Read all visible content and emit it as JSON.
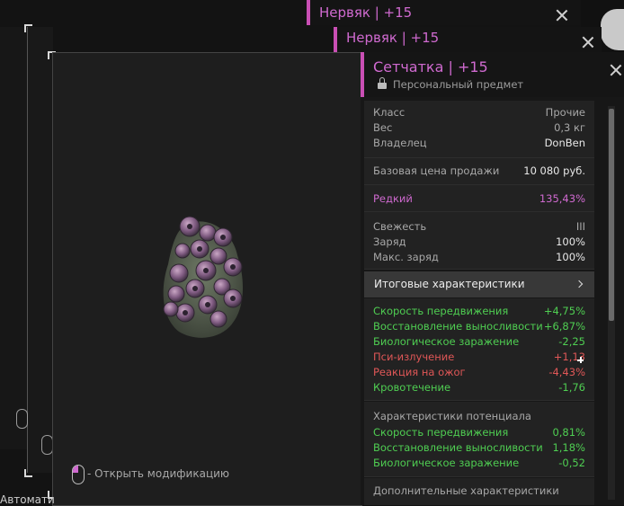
{
  "back_windows": [
    {
      "title": "Нервяк | +15"
    },
    {
      "title": "Нервяк | +15"
    }
  ],
  "window": {
    "title": "Сетчатка | +15",
    "subtitle": "Персональный предмет",
    "colors": {
      "accent": "#c94fb4",
      "positive": "#4fce52",
      "negative": "#e05757",
      "rare": "#d06ad0"
    }
  },
  "info": {
    "class_label": "Класс",
    "class_value": "Прочие",
    "weight_label": "Вес",
    "weight_value": "0,3 кг",
    "owner_label": "Владелец",
    "owner_value": "DonBen"
  },
  "price": {
    "label": "Базовая цена продажи",
    "value": "10 080 руб."
  },
  "rarity": {
    "label": "Редкий",
    "value": "135,43%"
  },
  "condition": {
    "freshness_label": "Свежесть",
    "freshness_value": "III",
    "charge_label": "Заряд",
    "charge_value": "100%",
    "max_charge_label": "Макс. заряд",
    "max_charge_value": "100%"
  },
  "final_stats": {
    "header": "Итоговые характеристики",
    "items": [
      {
        "label": "Скорость передвижения",
        "value": "+4,75%",
        "tone": "green"
      },
      {
        "label": "Восстановление выносливости",
        "value": "+6,87%",
        "tone": "green"
      },
      {
        "label": "Биологическое заражение",
        "value": "-2,25",
        "tone": "green"
      },
      {
        "label": "Пси-излучение",
        "value": "+1,13",
        "tone": "red"
      },
      {
        "label": "Реакция на ожог",
        "value": "-4,43%",
        "tone": "red"
      },
      {
        "label": "Кровотечение",
        "value": "-1,76",
        "tone": "green"
      }
    ]
  },
  "potential_stats": {
    "header": "Характеристики потенциала",
    "items": [
      {
        "label": "Скорость передвижения",
        "value": "0,81%",
        "tone": "green"
      },
      {
        "label": "Восстановление выносливости",
        "value": "1,18%",
        "tone": "green"
      },
      {
        "label": "Биологическое заражение",
        "value": "-0,52",
        "tone": "green"
      }
    ]
  },
  "extra": {
    "header": "Дополнительные характеристики"
  },
  "hint": {
    "text": "- Открыть модификацию"
  },
  "bottom_left_text": "Автомати",
  "icons": [
    "close-icon",
    "lock-icon",
    "chevron-right-icon",
    "mouse-icon",
    "artifact-image"
  ]
}
